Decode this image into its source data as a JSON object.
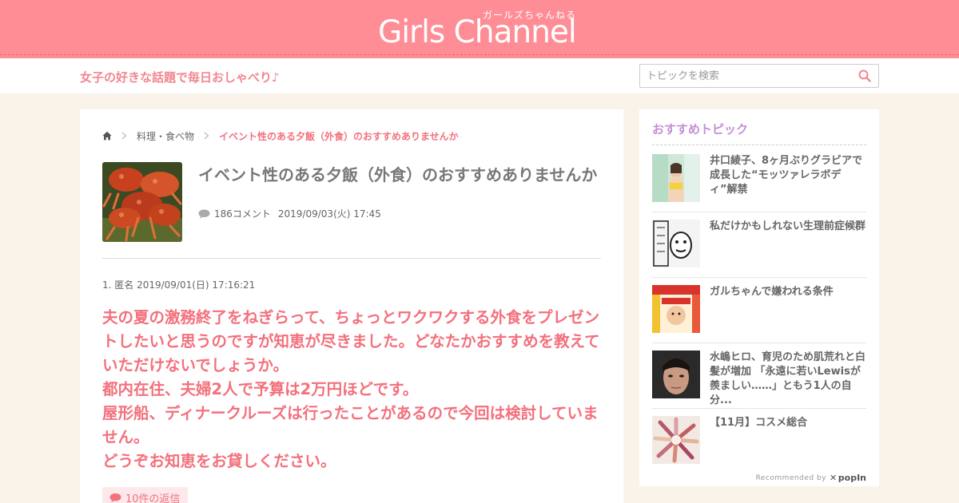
{
  "colors": {
    "header_bg": "#ff8d96",
    "accent": "#f2717d",
    "page_bg": "#faf3ea",
    "sidebar_title": "#c58ed6"
  },
  "header": {
    "logo_kana": "ガールズちゃんねる",
    "logo_text": "Girls Channel",
    "tagline": "女子の好きな話題で毎日おしゃべり♪"
  },
  "search": {
    "placeholder": "トピックを検索",
    "icon": "search-icon"
  },
  "breadcrumb": {
    "home_icon": "home-icon",
    "category": "料理・食べ物",
    "current": "イベント性のある夕飯（外食）のおすすめありませんか"
  },
  "topic": {
    "title": "イベント性のある夕飯（外食）のおすすめありませんか",
    "comment_count": "186コメント",
    "date": "2019/09/03(火) 17:45"
  },
  "comment": {
    "header": "1. 匿名 2019/09/01(日) 17:16:21",
    "lines": [
      "夫の夏の激務終了をねぎらって、ちょっとワクワクする外食をプレゼントしたいと思うのですが知恵が尽きました。どなたかおすすめを教えていただけないでしょうか。",
      "都内在住、夫婦2人で予算は2万円ほどです。",
      "屋形船、ディナークルーズは行ったことがあるので今回は検討していません。",
      "どうぞお知恵をお貸しください。"
    ],
    "reply_label": "10件の返信"
  },
  "sidebar": {
    "title": "おすすめトピック",
    "items": [
      {
        "text": "井口綾子、8ヶ月ぶりグラビアで成長した“モッツァレラボディ”解禁"
      },
      {
        "text": "私だけかもしれない生理前症候群"
      },
      {
        "text": "ガルちゃんで嫌われる条件"
      },
      {
        "text": "水嶋ヒロ、育児のため肌荒れと白髪が増加 「永遠に若いLewisが羨ましい……」ともう1人の自分..."
      },
      {
        "text": "【11月】コスメ総合"
      }
    ],
    "recommended_by": "Recommended by",
    "brand": "popIn"
  }
}
